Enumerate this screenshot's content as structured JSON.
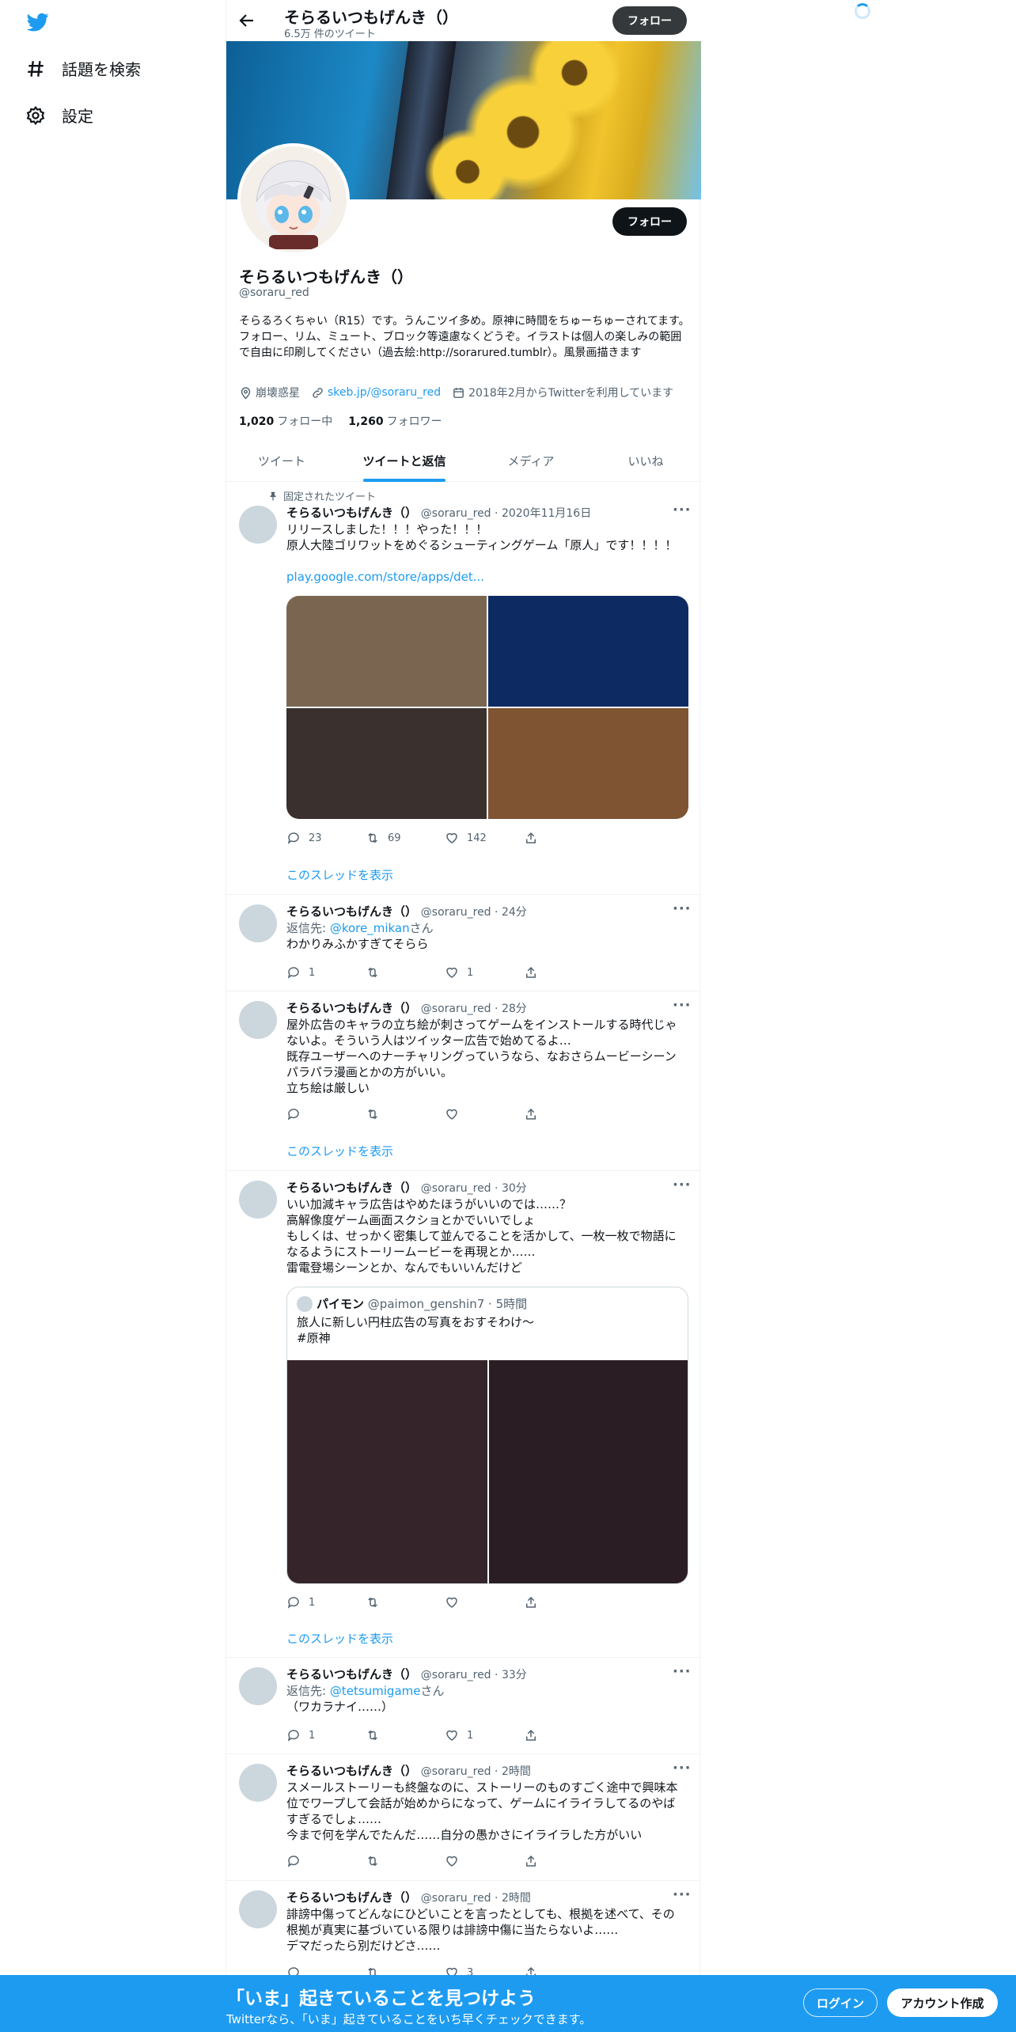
{
  "nav": {
    "explore_label": "話題を検索",
    "settings_label": "設定"
  },
  "header": {
    "name": "そらるいつもげんき（）",
    "tweet_count": "6.5万 件のツイート",
    "follow_label": "フォロー"
  },
  "profile": {
    "name": "そらるいつもげんき（）",
    "handle": "@soraru_red",
    "follow_label": "フォロー",
    "bio": "そらるろくちゃい（R15）です。うんこツイ多め。原神に時間をちゅーちゅーされてます。フォロー、リム、ミュート、ブロック等遠慮なくどうぞ。イラストは個人の楽しみの範囲で自由に印刷してください（過去絵:http://sorarured.tumblr）。風景画描きます",
    "location": "崩壊惑星",
    "link": "skeb.jp/@soraru_red",
    "joined": "2018年2月からTwitterを利用しています",
    "following_count": "1,020",
    "following_label": "フォロー中",
    "followers_count": "1,260",
    "followers_label": "フォロワー"
  },
  "tabs": [
    {
      "label": "ツイート"
    },
    {
      "label": "ツイートと返信"
    },
    {
      "label": "メディア"
    },
    {
      "label": "いいね"
    }
  ],
  "tweets": [
    {
      "pinned_label": "固定されたツイート",
      "name": "そらるいつもげんき（）",
      "handle": "@soraru_red",
      "time": "2020年11月16日",
      "text_lines": [
        "リリースしました！！！やった！！！",
        "原人大陸ゴリワットをめぐるシューティングゲーム「原人」です！！！！"
      ],
      "link": "play.google.com/store/apps/det...",
      "media_colors": [
        "#7a6650",
        "#0e2a63",
        "#3a302e",
        "#7e5432"
      ],
      "replies": "23",
      "retweets": "69",
      "likes": "142",
      "thread_label": "このスレッドを表示"
    },
    {
      "name": "そらるいつもげんき（）",
      "handle": "@soraru_red",
      "time": "24分",
      "reply_prefix": "返信先: ",
      "reply_to": "@kore_mikan",
      "reply_suffix": "さん",
      "text_lines": [
        "わかりみふかすぎてそらら"
      ],
      "replies": "1",
      "retweets": "",
      "likes": "1"
    },
    {
      "name": "そらるいつもげんき（）",
      "handle": "@soraru_red",
      "time": "28分",
      "text_lines": [
        "屋外広告のキャラの立ち絵が刺さってゲームをインストールする時代じゃ",
        "ないよ。そういう人はツイッター広告で始めてるよ…",
        "既存ユーザーへのナーチャリングっていうなら、なおさらムービーシーン",
        "パラパラ漫画とかの方がいい。",
        "立ち絵は厳しい"
      ],
      "replies": "",
      "retweets": "",
      "likes": "",
      "thread_label": "このスレッドを表示"
    },
    {
      "name": "そらるいつもげんき（）",
      "handle": "@soraru_red",
      "time": "30分",
      "text_lines": [
        "いい加減キャラ広告はやめたほうがいいのでは……？",
        "高解像度ゲーム画面スクショとかでいいでしょ",
        "もしくは、せっかく密集して並んでることを活かして、一枚一枚で物語に",
        "なるようにストーリームービーを再現とか……",
        "雷電登場シーンとか、なんでもいいんだけど"
      ],
      "quote": {
        "name": "パイモン",
        "handle": "@paimon_genshin7",
        "time": "5時間",
        "text_lines": [
          "旅人に新しい円柱広告の写真をおすそわけ〜",
          "#原神"
        ],
        "media_colors": [
          "#35252b",
          "#2a1d23"
        ]
      },
      "replies": "1",
      "retweets": "",
      "likes": "",
      "thread_label": "このスレッドを表示"
    },
    {
      "name": "そらるいつもげんき（）",
      "handle": "@soraru_red",
      "time": "33分",
      "reply_prefix": "返信先: ",
      "reply_to": "@tetsumigame",
      "reply_suffix": "さん",
      "text_lines": [
        "（ワカラナイ……）"
      ],
      "replies": "1",
      "retweets": "",
      "likes": "1"
    },
    {
      "name": "そらるいつもげんき（）",
      "handle": "@soraru_red",
      "time": "2時間",
      "text_lines": [
        "スメールストーリーも終盤なのに、ストーリーのものすごく途中で興味本",
        "位でワープして会話が始めからになって、ゲームにイライラしてるのやば",
        "すぎるでしょ……",
        "今まで何を学んでたんだ……自分の愚かさにイライラした方がいい"
      ],
      "replies": "",
      "retweets": "",
      "likes": ""
    },
    {
      "name": "そらるいつもげんき（）",
      "handle": "@soraru_red",
      "time": "2時間",
      "text_lines": [
        "誹謗中傷ってどんなにひどいことを言ったとしても、根拠を述べて、その",
        "根拠が真実に基づいている限りは誹謗中傷に当たらないよ……",
        "デマだったら別だけどさ……"
      ],
      "replies": "",
      "retweets": "",
      "likes": "3"
    }
  ],
  "bottom": {
    "title": "「いま」起きていることを見つけよう",
    "subtitle": "Twitterなら、「いま」起きていることをいち早くチェックできます。",
    "login_label": "ログイン",
    "signup_label": "アカウント作成"
  },
  "colors": {
    "accent": "#1d9bf0",
    "dark_button": "#0f1419"
  }
}
